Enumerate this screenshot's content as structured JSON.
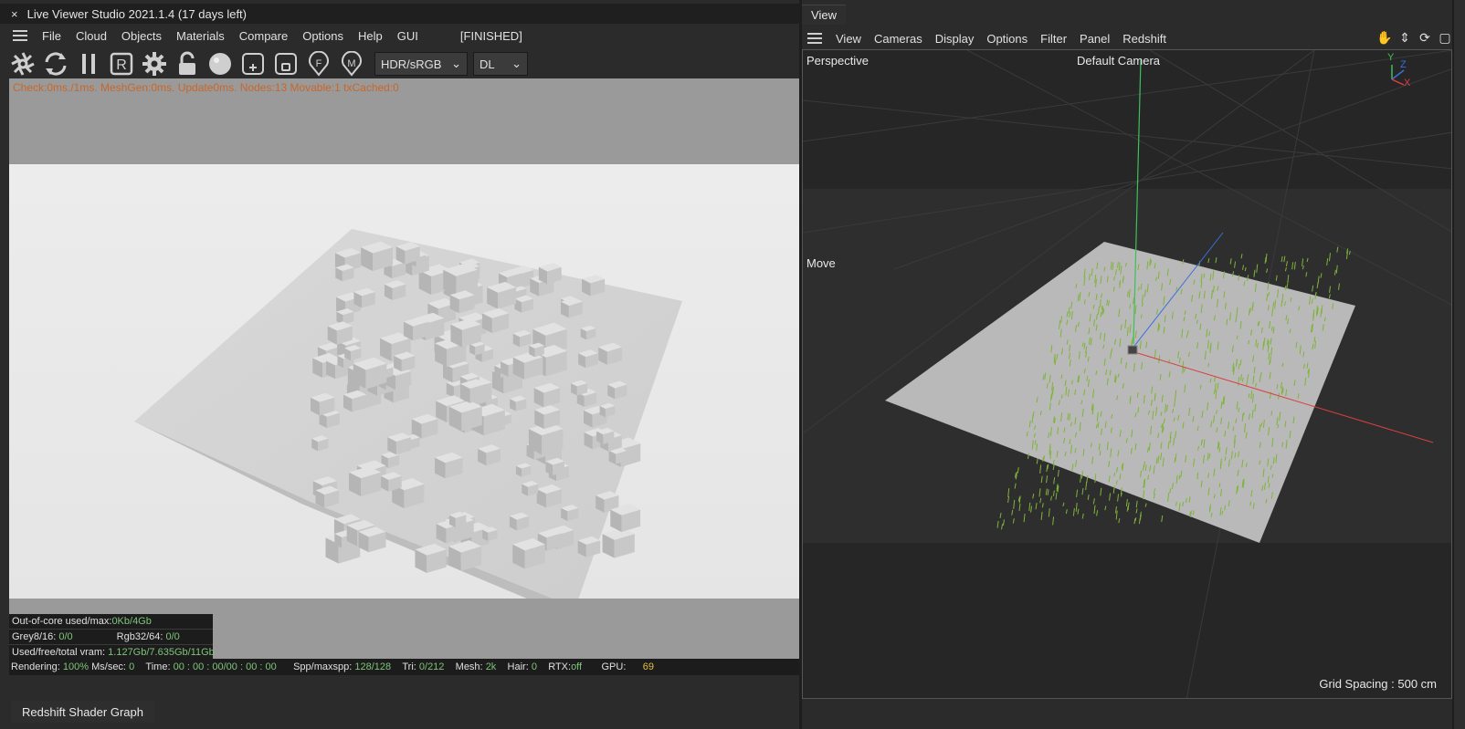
{
  "live_viewer": {
    "title": "Live Viewer Studio 2021.1.4 (17 days left)",
    "close_label": "×",
    "menu": [
      "File",
      "Cloud",
      "Objects",
      "Materials",
      "Compare",
      "Options",
      "Help",
      "GUI"
    ],
    "finished_label": "[FINISHED]",
    "toolbar_icons": [
      "aperture-icon",
      "refresh-icon",
      "pause-icon",
      "region-icon",
      "settings-gear-icon",
      "lock-icon",
      "sphere-icon",
      "add-frame-icon",
      "frame-icon",
      "focus-icon",
      "material-icon"
    ],
    "color_space_select": "HDR/sRGB",
    "mode_select": "DL",
    "stats_line": "Check:0ms./1ms. MeshGen:0ms. Update0ms. Nodes:13 Movable:1 txCached:0",
    "memory_info": {
      "out_of_core_label": "Out-of-core used/max:",
      "out_of_core_value": "0Kb/4Gb",
      "grey_label": "Grey8/16:",
      "grey_value": "0/0",
      "rgb_label": "Rgb32/64:",
      "rgb_value": "0/0",
      "vram_label": "Used/free/total vram:",
      "vram_value": "1.127Gb/7.635Gb/11Gb"
    },
    "status": {
      "rendering_label": "Rendering:",
      "rendering_value": "100%",
      "ms_label": "Ms/sec:",
      "ms_value": "0",
      "time_label": "Time:",
      "time_value": "00 : 00 : 00/00 : 00 : 00",
      "spp_label": "Spp/maxspp:",
      "spp_value": "128/128",
      "tri_label": "Tri:",
      "tri_value": "0/212",
      "mesh_label": "Mesh:",
      "mesh_value": "2k",
      "hair_label": "Hair:",
      "hair_value": "0",
      "rtx_label": "RTX:",
      "rtx_value": "off",
      "gpu_label": "GPU:",
      "gpu_value": "69"
    },
    "shader_graph_tab": "Redshift Shader Graph"
  },
  "viewport": {
    "tab_label": "View",
    "menu": [
      "View",
      "Cameras",
      "Display",
      "Options",
      "Filter",
      "Panel",
      "Redshift"
    ],
    "tools": [
      "pan-icon",
      "move-vertical-icon",
      "rotate-icon",
      "maximize-icon"
    ],
    "projection_label": "Perspective",
    "camera_label": "Default Camera",
    "tool_label": "Move",
    "grid_spacing": "Grid Spacing : 500 cm",
    "axis_labels": {
      "y": "Y",
      "z": "Z",
      "x": "X"
    }
  },
  "colors": {
    "accent_orange": "#c8672a",
    "status_green": "#7fc47a",
    "grass_green": "#7fb43a",
    "axis_y": "#3fbf5a",
    "axis_x": "#d94040",
    "axis_z": "#3a6fd9"
  }
}
